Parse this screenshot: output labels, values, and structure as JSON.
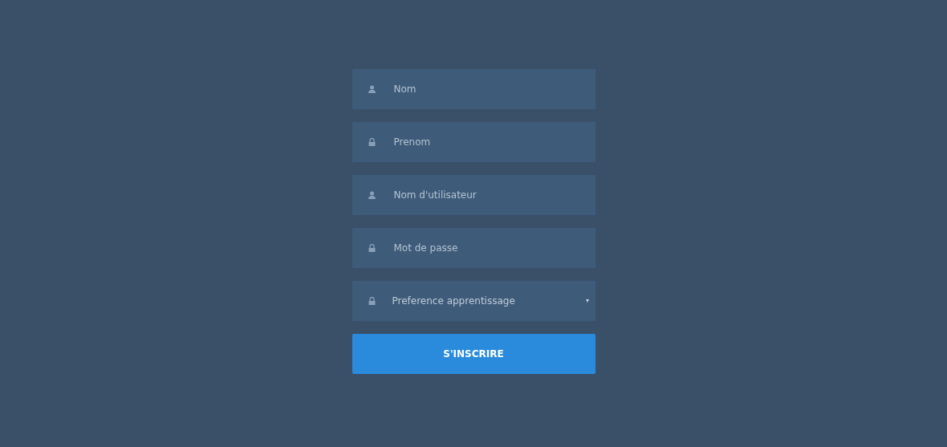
{
  "form": {
    "fields": [
      {
        "kind": "input",
        "placeholder": "Nom"
      },
      {
        "kind": "input",
        "placeholder": "Prenom"
      },
      {
        "kind": "input",
        "placeholder": "Nom d'utilisateur"
      },
      {
        "kind": "input",
        "placeholder": "Mot de passe"
      },
      {
        "kind": "select",
        "value": "Preference apprentissage"
      }
    ],
    "submit": "S'INSCRIRE"
  }
}
